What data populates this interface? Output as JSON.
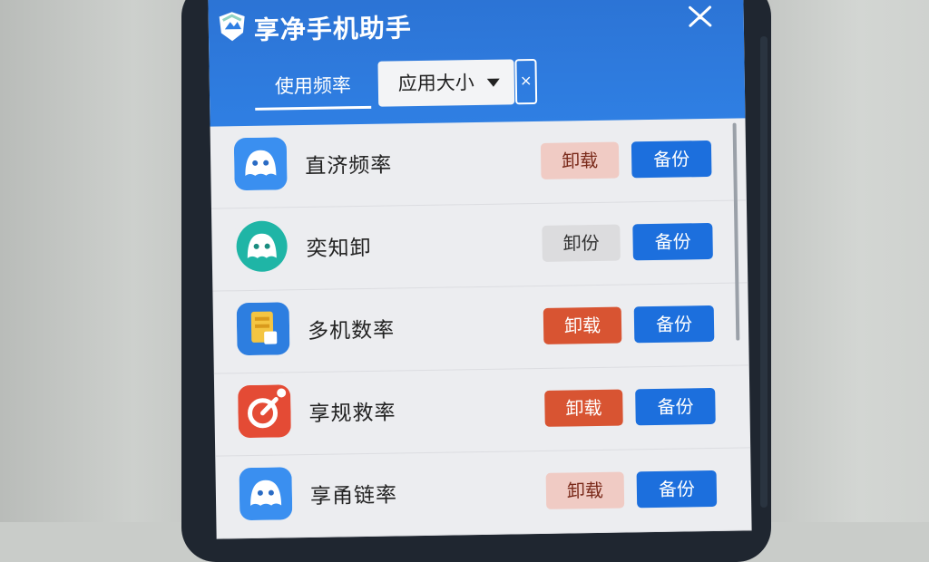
{
  "app": {
    "title": "享净手机助手",
    "brand_color": "#2f7fe3"
  },
  "tabs": {
    "usage_label": "使用频率",
    "size_label": "应用大小",
    "clear_label": "×"
  },
  "apps": [
    {
      "name": "直济频率",
      "uninstall_label": "卸载",
      "backup_label": "备份",
      "uninstall_style": "pale-red",
      "icon": "blue-ghost-icon"
    },
    {
      "name": "奕知卸",
      "uninstall_label": "卸份",
      "backup_label": "备份",
      "uninstall_style": "gray",
      "icon": "teal-ghost-icon"
    },
    {
      "name": "多机数率",
      "uninstall_label": "卸载",
      "backup_label": "备份",
      "uninstall_style": "red",
      "icon": "gold-trophy-icon"
    },
    {
      "name": "享规救率",
      "uninstall_label": "卸载",
      "backup_label": "备份",
      "uninstall_style": "red",
      "icon": "red-power-icon"
    },
    {
      "name": "享甬链率",
      "uninstall_label": "卸载",
      "backup_label": "备份",
      "uninstall_style": "pale-red",
      "icon": "blue-ghost-icon"
    }
  ],
  "colors": {
    "uninstall_red": "#d85432",
    "uninstall_pale": "#f0cbc4",
    "uninstall_gray": "#dcdcde",
    "backup_blue": "#1c6fdd"
  }
}
